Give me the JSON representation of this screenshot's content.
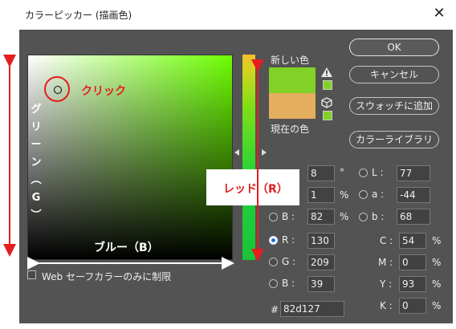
{
  "window": {
    "title": "カラーピッカー (描画色)",
    "close_glyph": "✕"
  },
  "annotations": {
    "click": "クリック",
    "green_vertical": [
      "グ",
      "リ",
      "ー",
      "ン",
      "︵",
      "G",
      "︶"
    ],
    "blue": "ブルー（B）",
    "red": "レッド（R）",
    "color": "#e31e1e"
  },
  "swatches": {
    "new_label": "新しい色",
    "current_label": "現在の色",
    "new_color": "#82d127",
    "current_color": "#e3ae5d",
    "warn_icon": "warning-triangle-icon",
    "cube_icon": "web-cube-icon"
  },
  "buttons": {
    "ok": "OK",
    "cancel": "キャンセル",
    "add_swatch": "スウォッチに追加",
    "libraries": "カラーライブラリ"
  },
  "hsb": {
    "h_value": "8",
    "h_unit": "°",
    "s_value": "1",
    "s_unit": "%",
    "b_label": "B :",
    "b_value": "82",
    "b_unit": "%"
  },
  "rgb": {
    "r_label": "R :",
    "r_value": "130",
    "g_label": "G :",
    "g_value": "209",
    "b_label": "B :",
    "b_value": "39"
  },
  "lab": {
    "l_label": "L :",
    "l_value": "77",
    "a_label": "a :",
    "a_value": "-44",
    "b_label": "b :",
    "b_value": "68"
  },
  "cmyk": {
    "c_label": "C :",
    "c_value": "54",
    "m_label": "M :",
    "m_value": "0",
    "y_label": "Y :",
    "y_value": "93",
    "k_label": "K :",
    "k_value": "0",
    "unit": "%"
  },
  "hex": {
    "label": "#",
    "value": "82d127"
  },
  "web_safe": {
    "label": "Web セーフカラーのみに制限"
  }
}
